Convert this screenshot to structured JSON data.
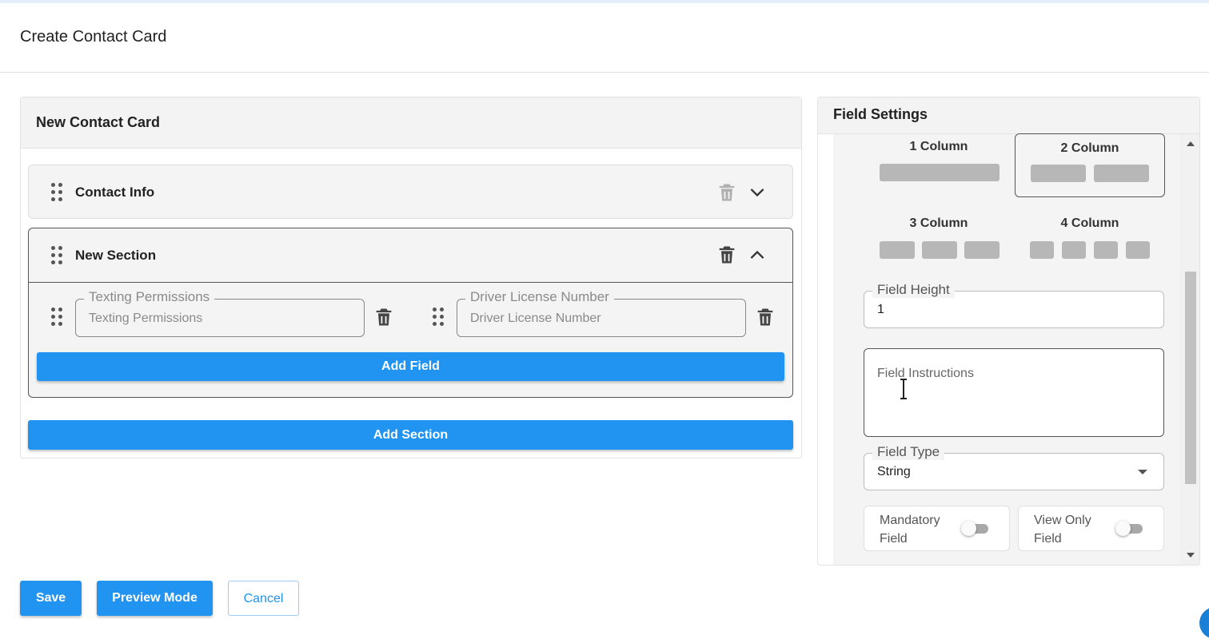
{
  "page": {
    "title": "Create Contact Card"
  },
  "builder": {
    "header": "New Contact Card",
    "sections": [
      {
        "title": "Contact Info"
      },
      {
        "title": "New Section",
        "fields": [
          {
            "label": "Texting Permissions",
            "placeholder": "Texting Permissions"
          },
          {
            "label": "Driver License Number",
            "placeholder": "Driver License Number"
          }
        ],
        "add_field_label": "Add Field"
      }
    ],
    "add_section_label": "Add Section"
  },
  "actions": {
    "save": "Save",
    "preview": "Preview Mode",
    "cancel": "Cancel"
  },
  "settings": {
    "title": "Field Settings",
    "layouts": [
      "1 Column",
      "2 Column",
      "3 Column",
      "4 Column"
    ],
    "selected_layout": "2 Column",
    "field_height": {
      "label": "Field Height",
      "value": "1"
    },
    "field_instructions": {
      "placeholder": "Field Instructions"
    },
    "field_type": {
      "label": "Field Type",
      "value": "String"
    },
    "mandatory": {
      "label": "Mandatory Field",
      "on": false
    },
    "view_only": {
      "label": "View Only Field",
      "on": false
    }
  },
  "colors": {
    "accent": "#2193f0",
    "panel_bg": "#f4f4f4",
    "border": "#555555"
  },
  "icons": [
    "drag-handle-icon",
    "trash-icon",
    "chevron-down-icon",
    "chevron-up-icon",
    "dropdown-arrow-icon"
  ]
}
